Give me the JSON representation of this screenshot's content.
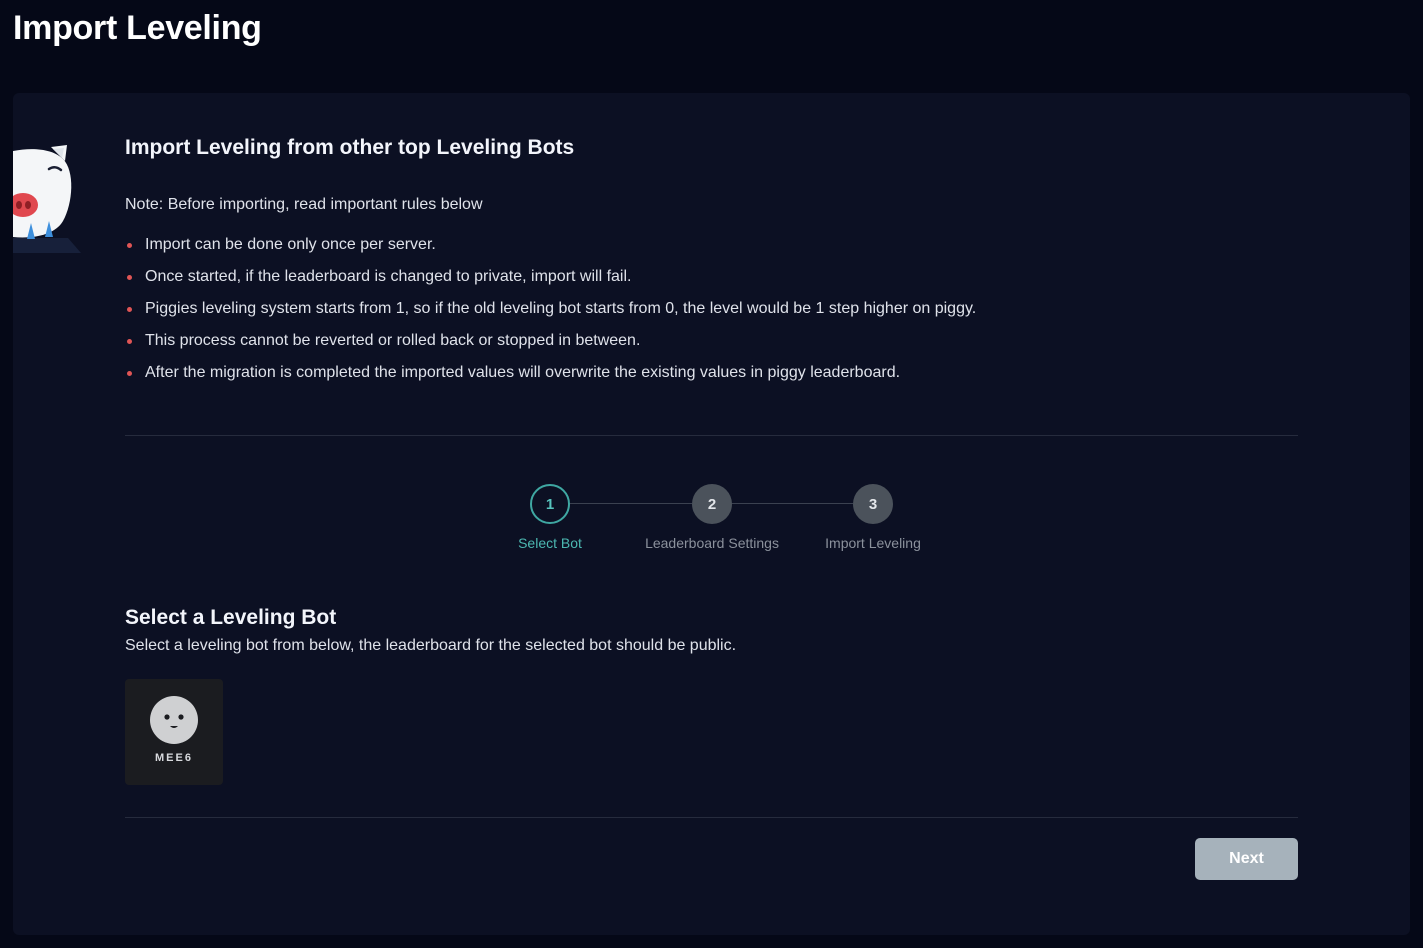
{
  "page": {
    "title": "Import Leveling"
  },
  "intro": {
    "heading": "Import Leveling from other top Leveling Bots",
    "note": "Note: Before importing, read important rules below",
    "rules": [
      "Import can be done only once per server.",
      "Once started, if the leaderboard is changed to private, import will fail.",
      "Piggies leveling system starts from 1, so if the old leveling bot starts from 0, the level would be 1 step higher on piggy.",
      "This process cannot be reverted or rolled back or stopped in between.",
      "After the migration is completed the imported values will overwrite the existing values in piggy leaderboard."
    ]
  },
  "stepper": {
    "current_step": 1,
    "steps": [
      {
        "number": "1",
        "label": "Select Bot",
        "status": "active"
      },
      {
        "number": "2",
        "label": "Leaderboard Settings",
        "status": "inactive"
      },
      {
        "number": "3",
        "label": "Import Leveling",
        "status": "inactive"
      }
    ]
  },
  "select_bot": {
    "heading": "Select a Leveling Bot",
    "description": "Select a leveling bot from below, the leaderboard for the selected bot should be public.",
    "bots": [
      {
        "name": "MEE6",
        "icon": "mee6-face-icon"
      }
    ]
  },
  "footer": {
    "next_label": "Next",
    "next_disabled": true
  },
  "colors": {
    "background": "#050817",
    "card": "#0c1023",
    "accent": "#3fa7a2",
    "bullet": "#e05555",
    "button_disabled": "#a6b2bb"
  }
}
